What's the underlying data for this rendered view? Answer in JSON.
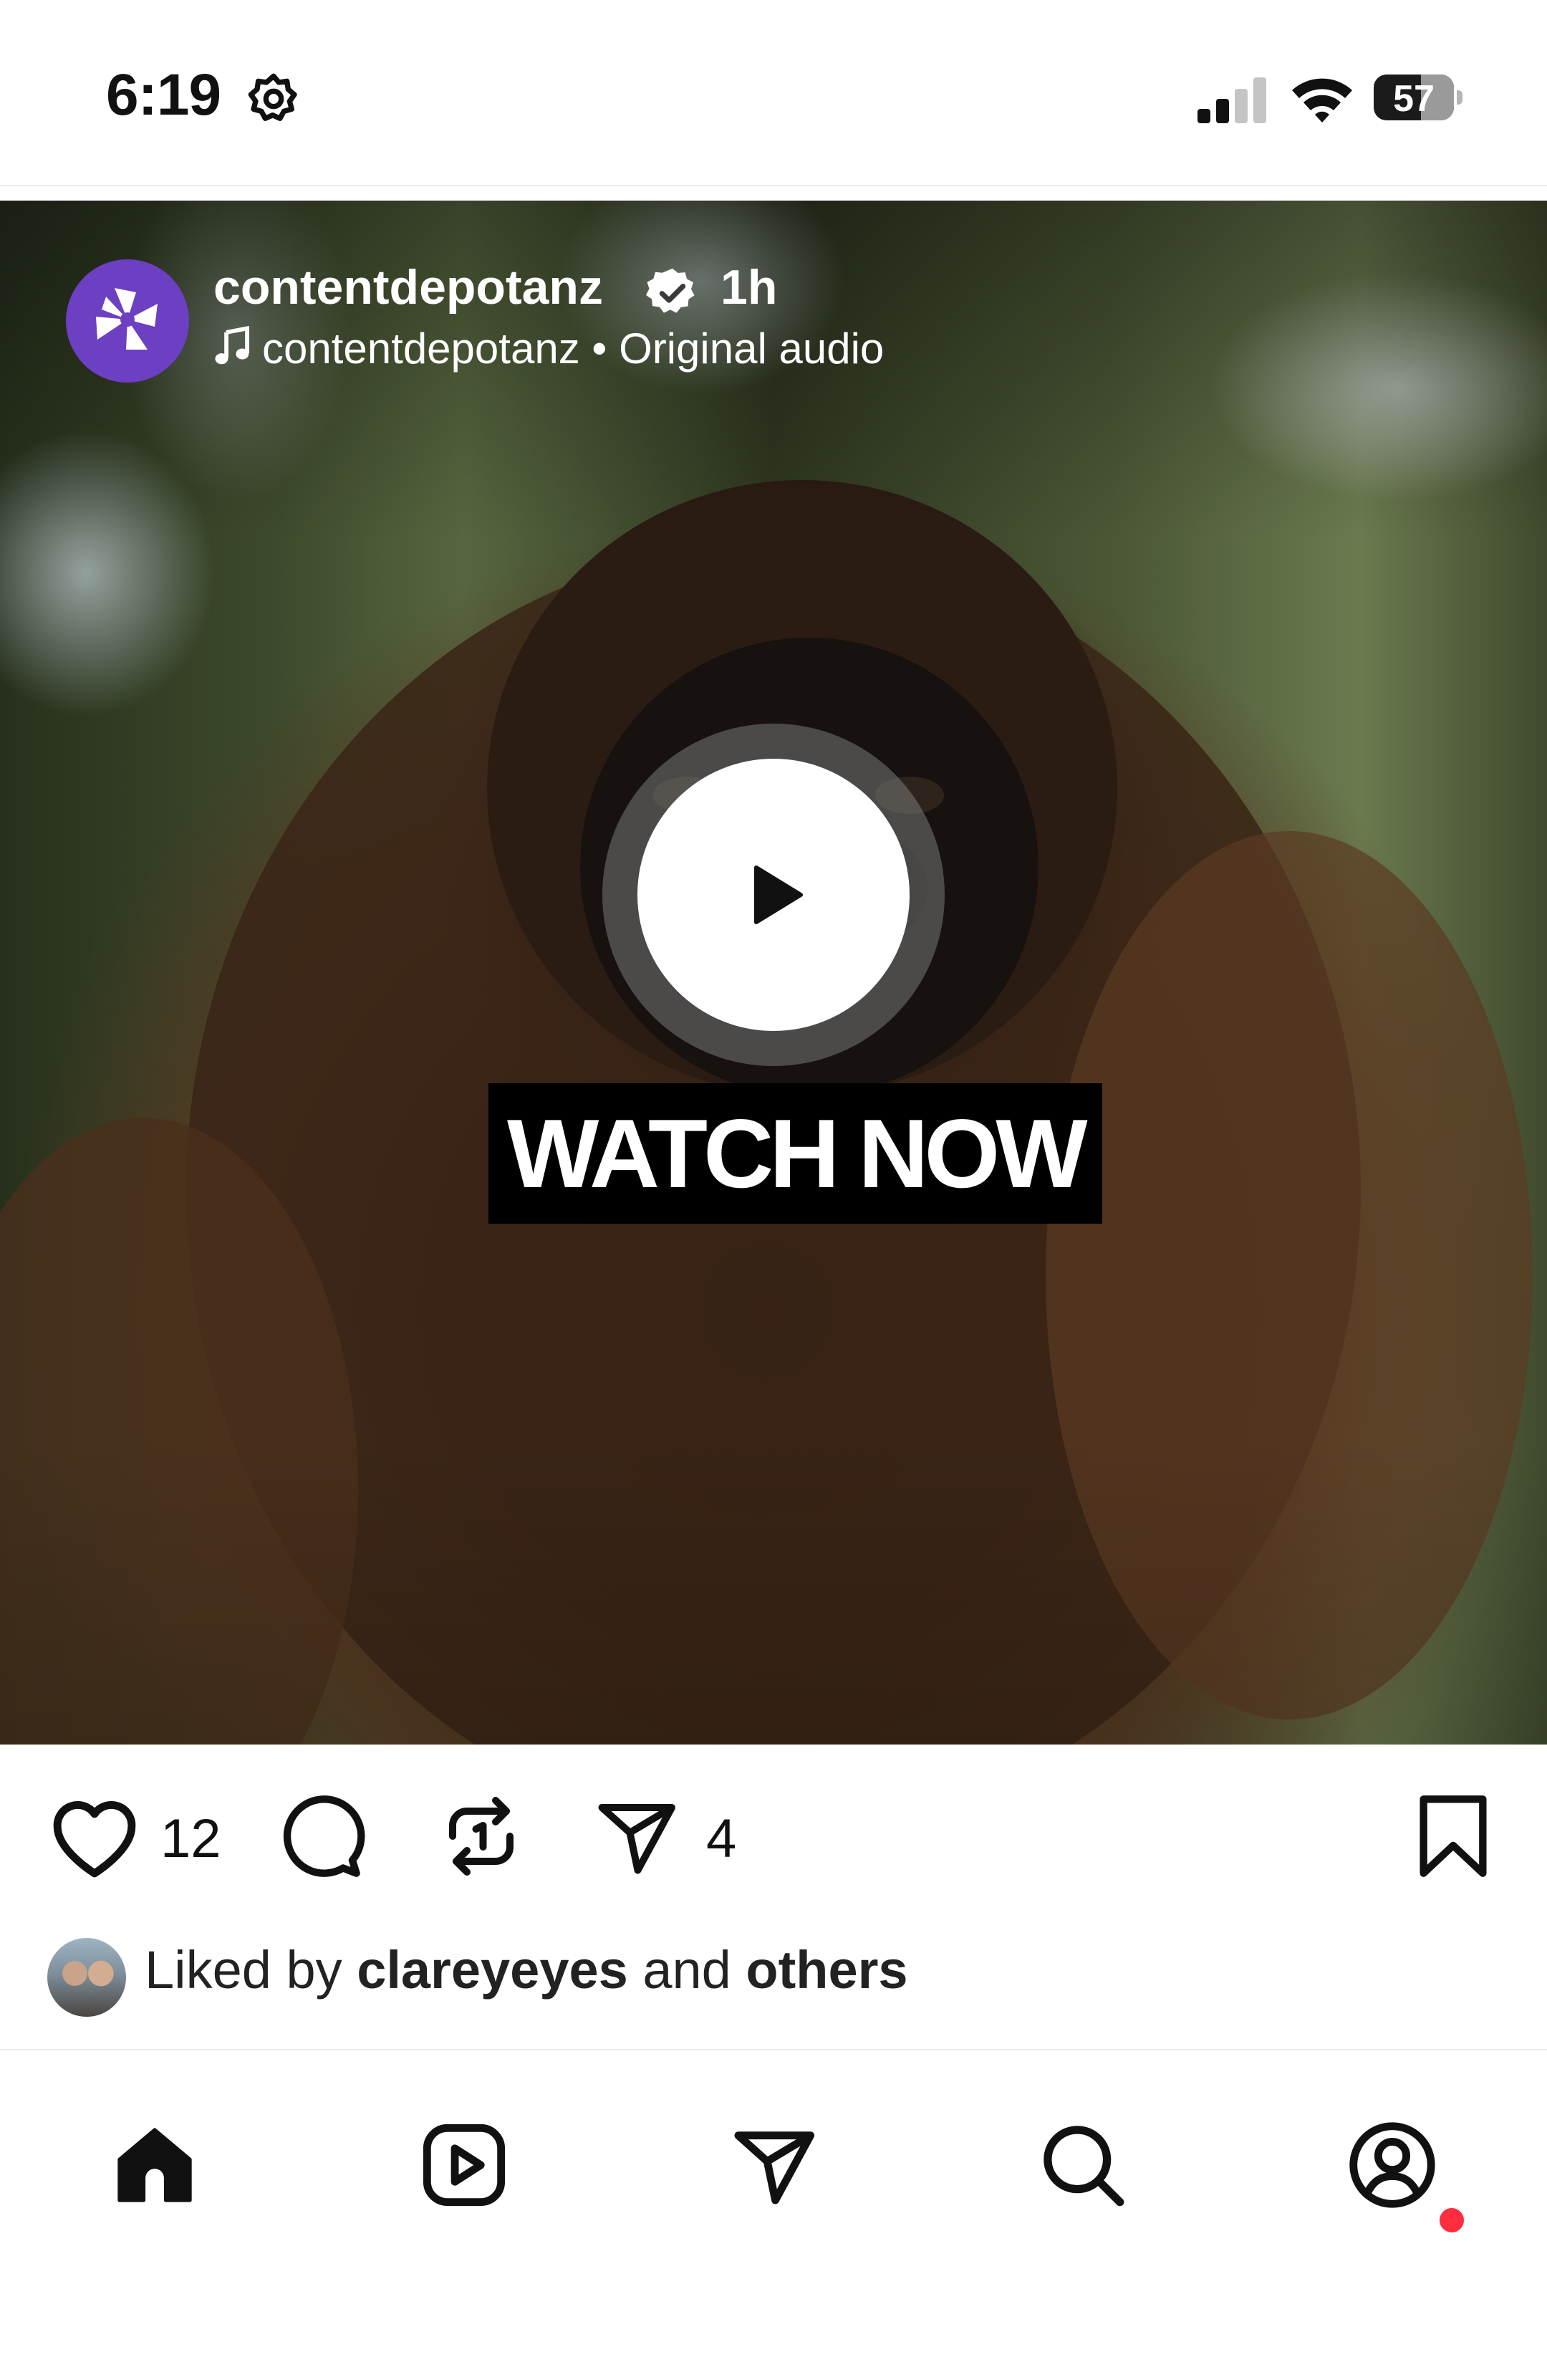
{
  "status_bar": {
    "time": "6:19",
    "battery": "57",
    "icons": [
      "settings-gear-icon",
      "cellular-signal-icon",
      "wifi-icon",
      "battery-icon"
    ]
  },
  "post": {
    "username": "contentdepotanz",
    "verified": true,
    "time_ago": "1h",
    "audio_user": "contentdepotanz",
    "audio_separator": "•",
    "audio_title": "Original audio",
    "overlay_text": "WATCH NOW",
    "avatar_color": "#6d3fc2"
  },
  "actions": {
    "like_count": "12",
    "share_count": "4",
    "icons": [
      "heart-icon",
      "comment-icon",
      "repost-icon",
      "send-icon",
      "bookmark-icon"
    ]
  },
  "liked_by": {
    "prefix": "Liked by",
    "user": "clareyeyes",
    "middle": "and",
    "others": "others"
  },
  "nav": {
    "items": [
      "home",
      "reels",
      "messages",
      "search",
      "profile"
    ],
    "notification_dot_color": "#ff2d3d"
  }
}
